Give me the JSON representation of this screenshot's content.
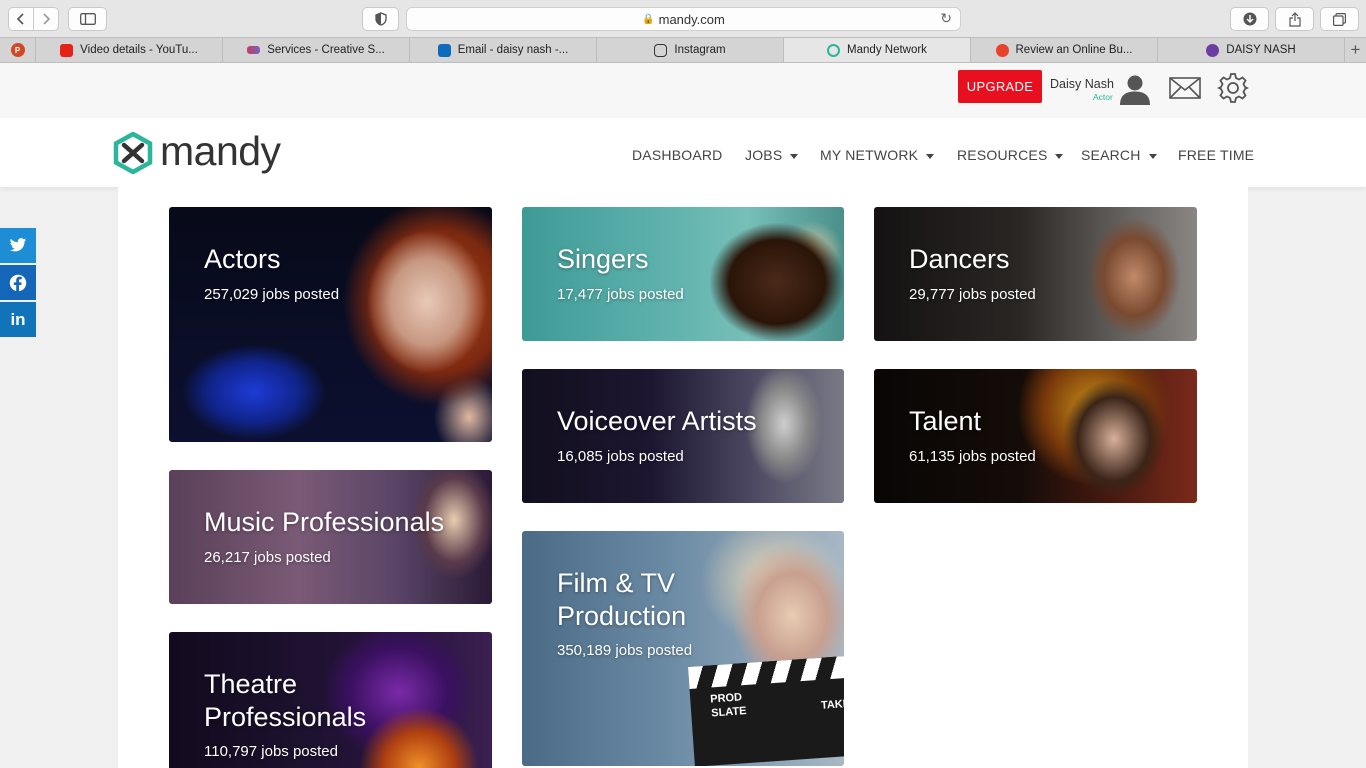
{
  "browser": {
    "url": "mandy.com",
    "tabs": [
      {
        "label": "Video details - YouTu...",
        "color": "#e62117"
      },
      {
        "label": "Services - Creative S...",
        "color": "#c04060"
      },
      {
        "label": "Email - daisy nash -...",
        "color": "#0f6cbd"
      },
      {
        "label": "Instagram",
        "color": "#333333"
      },
      {
        "label": "Mandy Network",
        "color": "#2bb59a"
      },
      {
        "label": "Review an Online Bu...",
        "color": "#e8412c"
      },
      {
        "label": "DAISY NASH",
        "color": "#6b3fa0"
      }
    ]
  },
  "userbar": {
    "upgrade_label": "UPGRADE",
    "user_name": "Daisy Nash",
    "user_role": "Actor"
  },
  "nav": {
    "logo_text": "mandy",
    "items": [
      {
        "label": "DASHBOARD"
      },
      {
        "label": "JOBS"
      },
      {
        "label": "MY NETWORK"
      },
      {
        "label": "RESOURCES"
      },
      {
        "label": "SEARCH"
      },
      {
        "label": "FREE TIME"
      }
    ]
  },
  "social": [
    {
      "icon": "twitter-icon",
      "label": "t"
    },
    {
      "icon": "facebook-icon",
      "label": "f"
    },
    {
      "icon": "linkedin-icon",
      "label": "in"
    }
  ],
  "categories": [
    {
      "title": "Actors",
      "count": "257,029 jobs posted"
    },
    {
      "title": "Singers",
      "count": "17,477 jobs posted"
    },
    {
      "title": "Dancers",
      "count": "29,777 jobs posted"
    },
    {
      "title": "Voiceover Artists",
      "count": "16,085 jobs posted"
    },
    {
      "title": "Talent",
      "count": "61,135 jobs posted"
    },
    {
      "title": "Music Professionals",
      "count": "26,217 jobs posted"
    },
    {
      "title": "Film & TV Production",
      "count": "350,189 jobs posted",
      "clapper_label_1": "PROD",
      "clapper_label_2": "SLATE",
      "clapper_label_3": "TAKE"
    },
    {
      "title": "Theatre Professionals",
      "count": "110,797 jobs posted"
    }
  ]
}
